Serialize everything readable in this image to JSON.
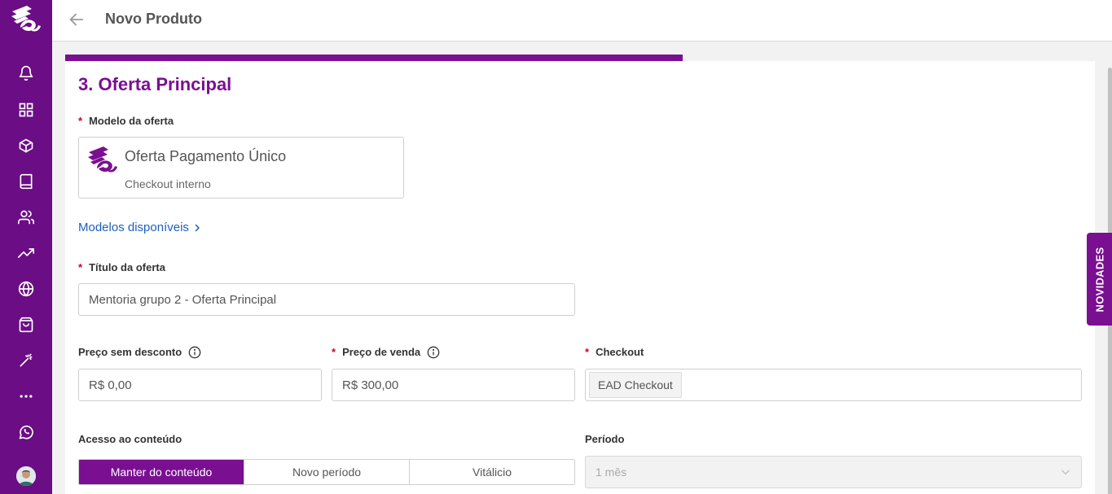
{
  "app": {
    "brand_color": "#6b0d84",
    "accent_color": "#7a0f91",
    "link_color": "#1f5fbf",
    "required_color": "#d0021b"
  },
  "sidebar": {
    "items": [
      {
        "name": "bell-icon"
      },
      {
        "name": "grid-icon"
      },
      {
        "name": "box-icon"
      },
      {
        "name": "book-icon"
      },
      {
        "name": "users-icon"
      },
      {
        "name": "trending-up-icon"
      },
      {
        "name": "globe-icon"
      },
      {
        "name": "shopping-bag-icon"
      },
      {
        "name": "magic-wand-icon"
      },
      {
        "name": "more-icon"
      },
      {
        "name": "whatsapp-icon"
      }
    ]
  },
  "header": {
    "title": "Novo Produto"
  },
  "progress": {
    "fraction": 0.6
  },
  "section": {
    "title": "3. Oferta Principal"
  },
  "offer_model": {
    "label": "Modelo da oferta",
    "name": "Oferta Pagamento Único",
    "subtitle": "Checkout interno",
    "link": "Modelos disponíveis"
  },
  "offer_title": {
    "label": "Título da oferta",
    "value": "Mentoria grupo 2 - Oferta Principal"
  },
  "price_no_discount": {
    "label": "Preço sem desconto",
    "value": "R$ 0,00"
  },
  "sale_price": {
    "label": "Preço de venda",
    "value": "R$ 300,00"
  },
  "checkout": {
    "label": "Checkout",
    "tag": "EAD Checkout"
  },
  "access": {
    "label": "Acesso ao conteúdo",
    "options": [
      "Manter do conteúdo",
      "Novo período",
      "Vitálicio"
    ],
    "selected": 0
  },
  "period": {
    "label": "Período",
    "value": "1 mês"
  },
  "news_tab": {
    "label": "NOVIDADES"
  }
}
